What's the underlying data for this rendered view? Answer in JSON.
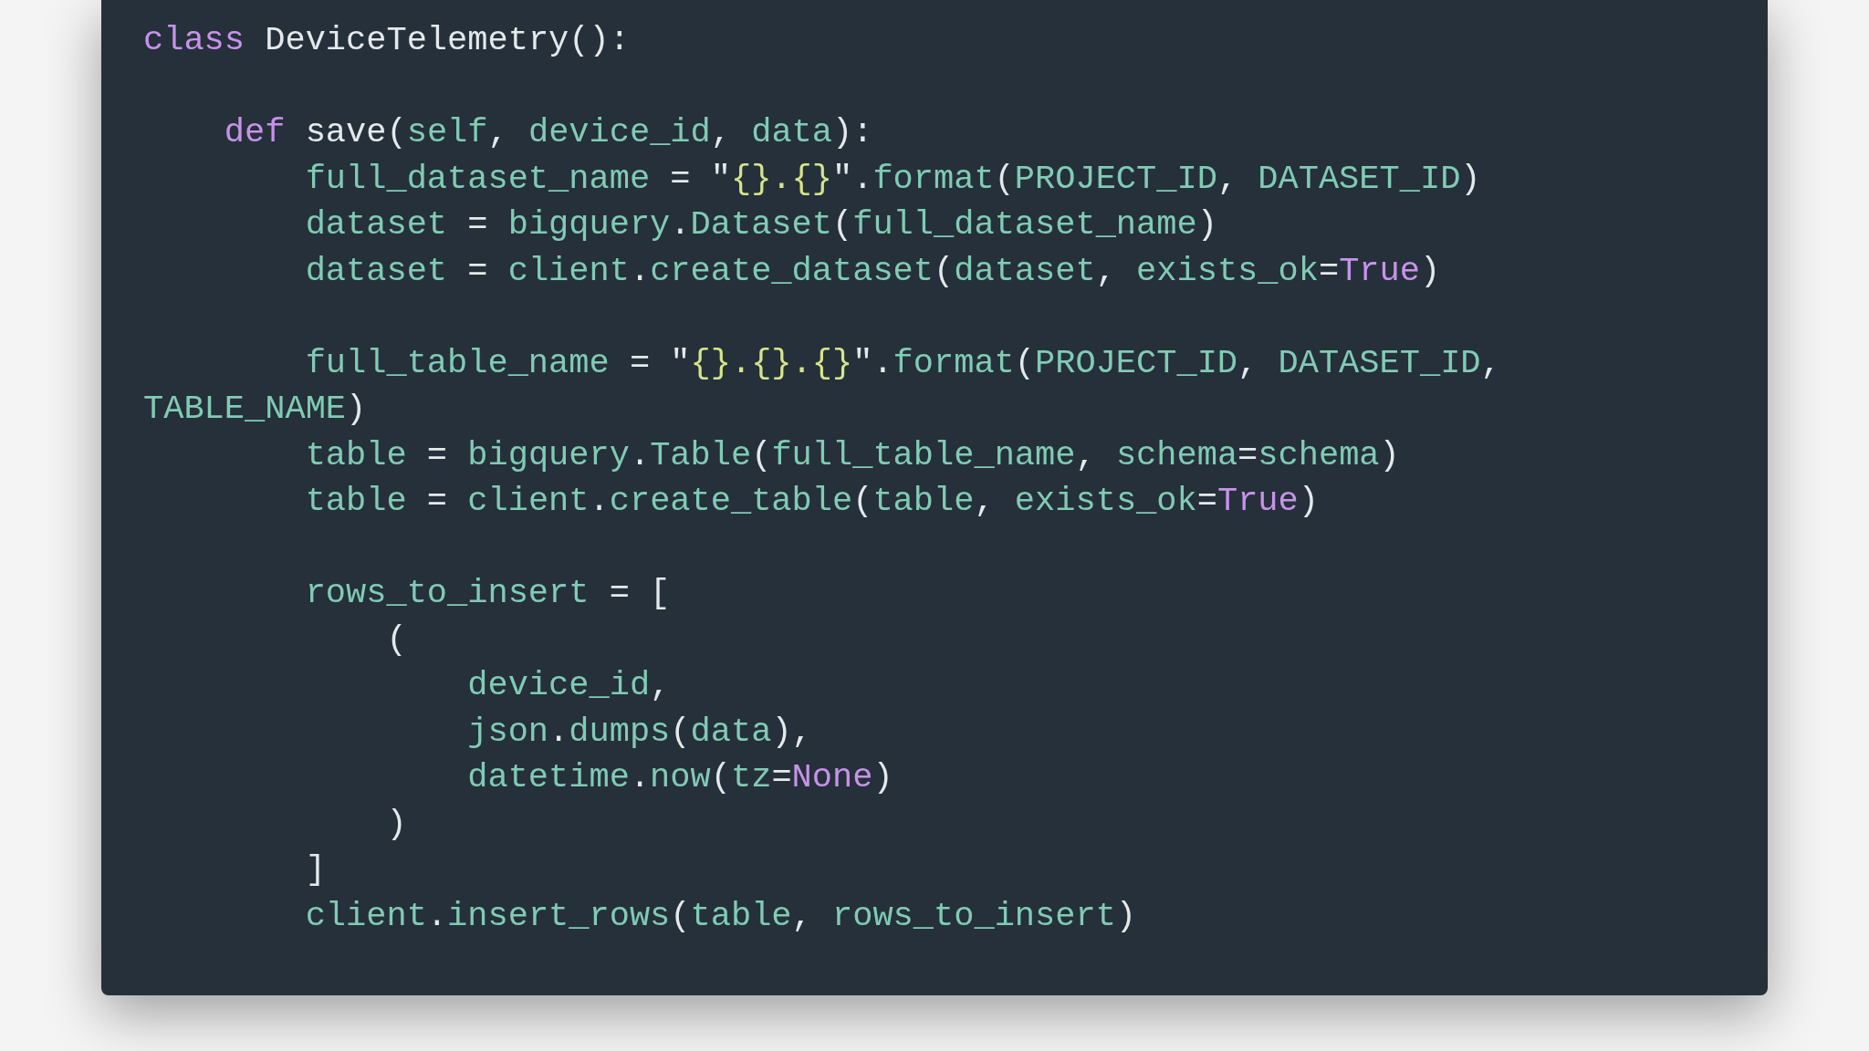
{
  "code_lines": [
    {
      "kind": "code",
      "tokens": [
        {
          "kind": "keyword",
          "text": "class"
        },
        {
          "kind": "plain",
          "text": " DeviceTelemetry():"
        }
      ],
      "children": [
        {
          "kind": "blank"
        },
        {
          "kind": "code",
          "tokens": [
            {
              "kind": "keyword",
              "text": "def"
            },
            {
              "kind": "plain",
              "text": " save("
            },
            {
              "kind": "name",
              "text": "self"
            },
            {
              "kind": "plain",
              "text": ", "
            },
            {
              "kind": "name",
              "text": "device_id"
            },
            {
              "kind": "plain",
              "text": ", "
            },
            {
              "kind": "name",
              "text": "data"
            },
            {
              "kind": "plain",
              "text": "):"
            }
          ],
          "children": [
            {
              "kind": "code",
              "tokens": [
                {
                  "kind": "name",
                  "text": "full_dataset_name"
                },
                {
                  "kind": "plain",
                  "text": " = \""
                },
                {
                  "kind": "string",
                  "text": "{}.{}"
                },
                {
                  "kind": "plain",
                  "text": "\"."
                },
                {
                  "kind": "name",
                  "text": "format"
                },
                {
                  "kind": "plain",
                  "text": "("
                },
                {
                  "kind": "name",
                  "text": "PROJECT_ID"
                },
                {
                  "kind": "plain",
                  "text": ", "
                },
                {
                  "kind": "name",
                  "text": "DATASET_ID"
                },
                {
                  "kind": "plain",
                  "text": ")"
                }
              ]
            },
            {
              "kind": "code",
              "tokens": [
                {
                  "kind": "name",
                  "text": "dataset"
                },
                {
                  "kind": "plain",
                  "text": " = "
                },
                {
                  "kind": "name",
                  "text": "bigquery"
                },
                {
                  "kind": "plain",
                  "text": "."
                },
                {
                  "kind": "name",
                  "text": "Dataset"
                },
                {
                  "kind": "plain",
                  "text": "("
                },
                {
                  "kind": "name",
                  "text": "full_dataset_name"
                },
                {
                  "kind": "plain",
                  "text": ")"
                }
              ]
            },
            {
              "kind": "code",
              "tokens": [
                {
                  "kind": "name",
                  "text": "dataset"
                },
                {
                  "kind": "plain",
                  "text": " = "
                },
                {
                  "kind": "name",
                  "text": "client"
                },
                {
                  "kind": "plain",
                  "text": "."
                },
                {
                  "kind": "name",
                  "text": "create_dataset"
                },
                {
                  "kind": "plain",
                  "text": "("
                },
                {
                  "kind": "name",
                  "text": "dataset"
                },
                {
                  "kind": "plain",
                  "text": ", "
                },
                {
                  "kind": "name",
                  "text": "exists_ok"
                },
                {
                  "kind": "plain",
                  "text": "="
                },
                {
                  "kind": "constant",
                  "text": "True"
                },
                {
                  "kind": "plain",
                  "text": ")"
                }
              ]
            },
            {
              "kind": "blank"
            },
            {
              "kind": "code",
              "tokens": [
                {
                  "kind": "name",
                  "text": "full_table_name"
                },
                {
                  "kind": "plain",
                  "text": " = \""
                },
                {
                  "kind": "string",
                  "text": "{}.{}.{}"
                },
                {
                  "kind": "plain",
                  "text": "\"."
                },
                {
                  "kind": "name",
                  "text": "format"
                },
                {
                  "kind": "plain",
                  "text": "("
                },
                {
                  "kind": "name",
                  "text": "PROJECT_ID"
                },
                {
                  "kind": "plain",
                  "text": ", "
                },
                {
                  "kind": "name",
                  "text": "DATASET_ID"
                },
                {
                  "kind": "plain",
                  "text": ","
                }
              ]
            },
            {
              "kind": "continuation",
              "tokens": [
                {
                  "kind": "name",
                  "text": "TABLE_NAME"
                },
                {
                  "kind": "plain",
                  "text": ")"
                }
              ]
            },
            {
              "kind": "code",
              "tokens": [
                {
                  "kind": "name",
                  "text": "table"
                },
                {
                  "kind": "plain",
                  "text": " = "
                },
                {
                  "kind": "name",
                  "text": "bigquery"
                },
                {
                  "kind": "plain",
                  "text": "."
                },
                {
                  "kind": "name",
                  "text": "Table"
                },
                {
                  "kind": "plain",
                  "text": "("
                },
                {
                  "kind": "name",
                  "text": "full_table_name"
                },
                {
                  "kind": "plain",
                  "text": ", "
                },
                {
                  "kind": "name",
                  "text": "schema"
                },
                {
                  "kind": "plain",
                  "text": "="
                },
                {
                  "kind": "name",
                  "text": "schema"
                },
                {
                  "kind": "plain",
                  "text": ")"
                }
              ]
            },
            {
              "kind": "code",
              "tokens": [
                {
                  "kind": "name",
                  "text": "table"
                },
                {
                  "kind": "plain",
                  "text": " = "
                },
                {
                  "kind": "name",
                  "text": "client"
                },
                {
                  "kind": "plain",
                  "text": "."
                },
                {
                  "kind": "name",
                  "text": "create_table"
                },
                {
                  "kind": "plain",
                  "text": "("
                },
                {
                  "kind": "name",
                  "text": "table"
                },
                {
                  "kind": "plain",
                  "text": ", "
                },
                {
                  "kind": "name",
                  "text": "exists_ok"
                },
                {
                  "kind": "plain",
                  "text": "="
                },
                {
                  "kind": "constant",
                  "text": "True"
                },
                {
                  "kind": "plain",
                  "text": ")"
                }
              ]
            },
            {
              "kind": "blank"
            },
            {
              "kind": "code",
              "tokens": [
                {
                  "kind": "name",
                  "text": "rows_to_insert"
                },
                {
                  "kind": "plain",
                  "text": " = ["
                }
              ],
              "children": [
                {
                  "kind": "code",
                  "tokens": [
                    {
                      "kind": "plain",
                      "text": "("
                    }
                  ],
                  "children": [
                    {
                      "kind": "code",
                      "tokens": [
                        {
                          "kind": "name",
                          "text": "device_id"
                        },
                        {
                          "kind": "plain",
                          "text": ","
                        }
                      ]
                    },
                    {
                      "kind": "code",
                      "tokens": [
                        {
                          "kind": "name",
                          "text": "json"
                        },
                        {
                          "kind": "plain",
                          "text": "."
                        },
                        {
                          "kind": "name",
                          "text": "dumps"
                        },
                        {
                          "kind": "plain",
                          "text": "("
                        },
                        {
                          "kind": "name",
                          "text": "data"
                        },
                        {
                          "kind": "plain",
                          "text": "),"
                        }
                      ]
                    },
                    {
                      "kind": "code",
                      "tokens": [
                        {
                          "kind": "name",
                          "text": "datetime"
                        },
                        {
                          "kind": "plain",
                          "text": "."
                        },
                        {
                          "kind": "name",
                          "text": "now"
                        },
                        {
                          "kind": "plain",
                          "text": "("
                        },
                        {
                          "kind": "name",
                          "text": "tz"
                        },
                        {
                          "kind": "plain",
                          "text": "="
                        },
                        {
                          "kind": "constant",
                          "text": "None"
                        },
                        {
                          "kind": "plain",
                          "text": ")"
                        }
                      ]
                    }
                  ]
                },
                {
                  "kind": "code",
                  "tokens": [
                    {
                      "kind": "plain",
                      "text": ")"
                    }
                  ]
                }
              ]
            },
            {
              "kind": "code",
              "tokens": [
                {
                  "kind": "plain",
                  "text": "]"
                }
              ]
            },
            {
              "kind": "code",
              "tokens": [
                {
                  "kind": "name",
                  "text": "client"
                },
                {
                  "kind": "plain",
                  "text": "."
                },
                {
                  "kind": "name",
                  "text": "insert_rows"
                },
                {
                  "kind": "plain",
                  "text": "("
                },
                {
                  "kind": "name",
                  "text": "table"
                },
                {
                  "kind": "plain",
                  "text": ", "
                },
                {
                  "kind": "name",
                  "text": "rows_to_insert"
                },
                {
                  "kind": "plain",
                  "text": ")"
                }
              ]
            }
          ]
        }
      ]
    }
  ]
}
